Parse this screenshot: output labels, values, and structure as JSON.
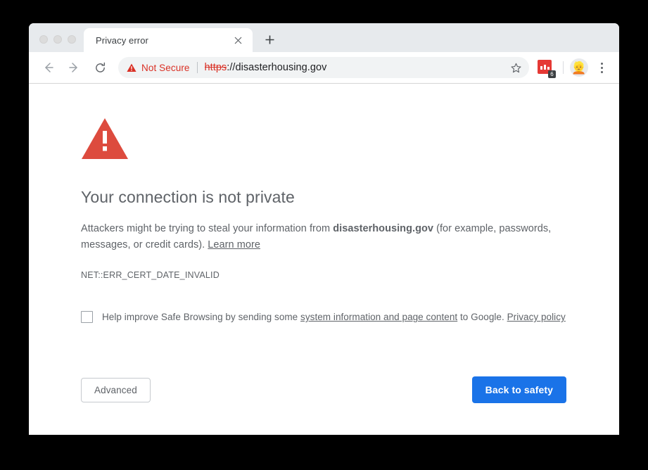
{
  "window": {
    "traffic_lights": [
      "close",
      "minimize",
      "zoom"
    ]
  },
  "tabs": [
    {
      "title": "Privacy error",
      "close_glyph": "×"
    }
  ],
  "new_tab_glyph": "+",
  "toolbar": {
    "back_glyph": "←",
    "forward_glyph": "→",
    "reload_glyph": "↻",
    "security_label": "Not Secure",
    "url_scheme": "https",
    "url_rest": "://disasterhousing.gov",
    "bookmark_glyph": "☆",
    "extension_badge": "6",
    "avatar_glyph": "👱",
    "menu_label": "Customize and control Google Chrome"
  },
  "page": {
    "heading": "Your connection is not private",
    "body_prefix": "Attackers might be trying to steal your information from ",
    "body_domain": "disasterhousing.gov",
    "body_suffix": " (for example, passwords, messages, or credit cards). ",
    "learn_more": "Learn more",
    "error_code": "NET::ERR_CERT_DATE_INVALID",
    "optin_prefix": "Help improve Safe Browsing by sending some ",
    "optin_link_1": "system information and page content",
    "optin_middle": " to Google. ",
    "optin_link_2": "Privacy policy",
    "advanced_label": "Advanced",
    "back_to_safety_label": "Back to safety"
  },
  "colors": {
    "warning_red": "#d93025",
    "triangle_red": "#dd4b3e",
    "primary_blue": "#1a73e8",
    "text_grey": "#5f6368",
    "tabstrip_grey": "#e7eaed",
    "omnibox_grey": "#f1f3f4"
  }
}
